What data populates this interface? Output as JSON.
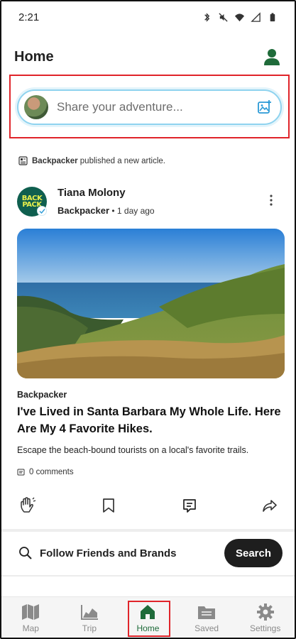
{
  "status_bar": {
    "time": "2:21"
  },
  "header": {
    "title": "Home"
  },
  "share": {
    "placeholder": "Share your adventure..."
  },
  "activity": {
    "brand": "Backpacker",
    "text": "published a new article."
  },
  "post": {
    "author": "Tiana Molony",
    "source": "Backpacker",
    "separator": "•",
    "time_ago": "1 day ago",
    "logo_text_1": "BACK",
    "logo_text_2": "PACK",
    "publication": "Backpacker",
    "title": "I've Lived in Santa Barbara My Whole Life. Here Are My 4 Favorite Hikes.",
    "description": "Escape the beach-bound tourists on a local's favorite trails.",
    "comments": "0 comments"
  },
  "follow": {
    "label": "Follow Friends and Brands",
    "button": "Search"
  },
  "nav": {
    "items": [
      {
        "label": "Map",
        "icon": "map-icon"
      },
      {
        "label": "Trip",
        "icon": "chart-icon"
      },
      {
        "label": "Home",
        "icon": "home-icon"
      },
      {
        "label": "Saved",
        "icon": "folder-icon"
      },
      {
        "label": "Settings",
        "icon": "gear-icon"
      }
    ],
    "active": "Home"
  },
  "colors": {
    "accent_green": "#1f6b3a",
    "highlight_red": "#e0242a",
    "share_border": "#8fd3ef",
    "brand_teal": "#0f5f4f"
  }
}
